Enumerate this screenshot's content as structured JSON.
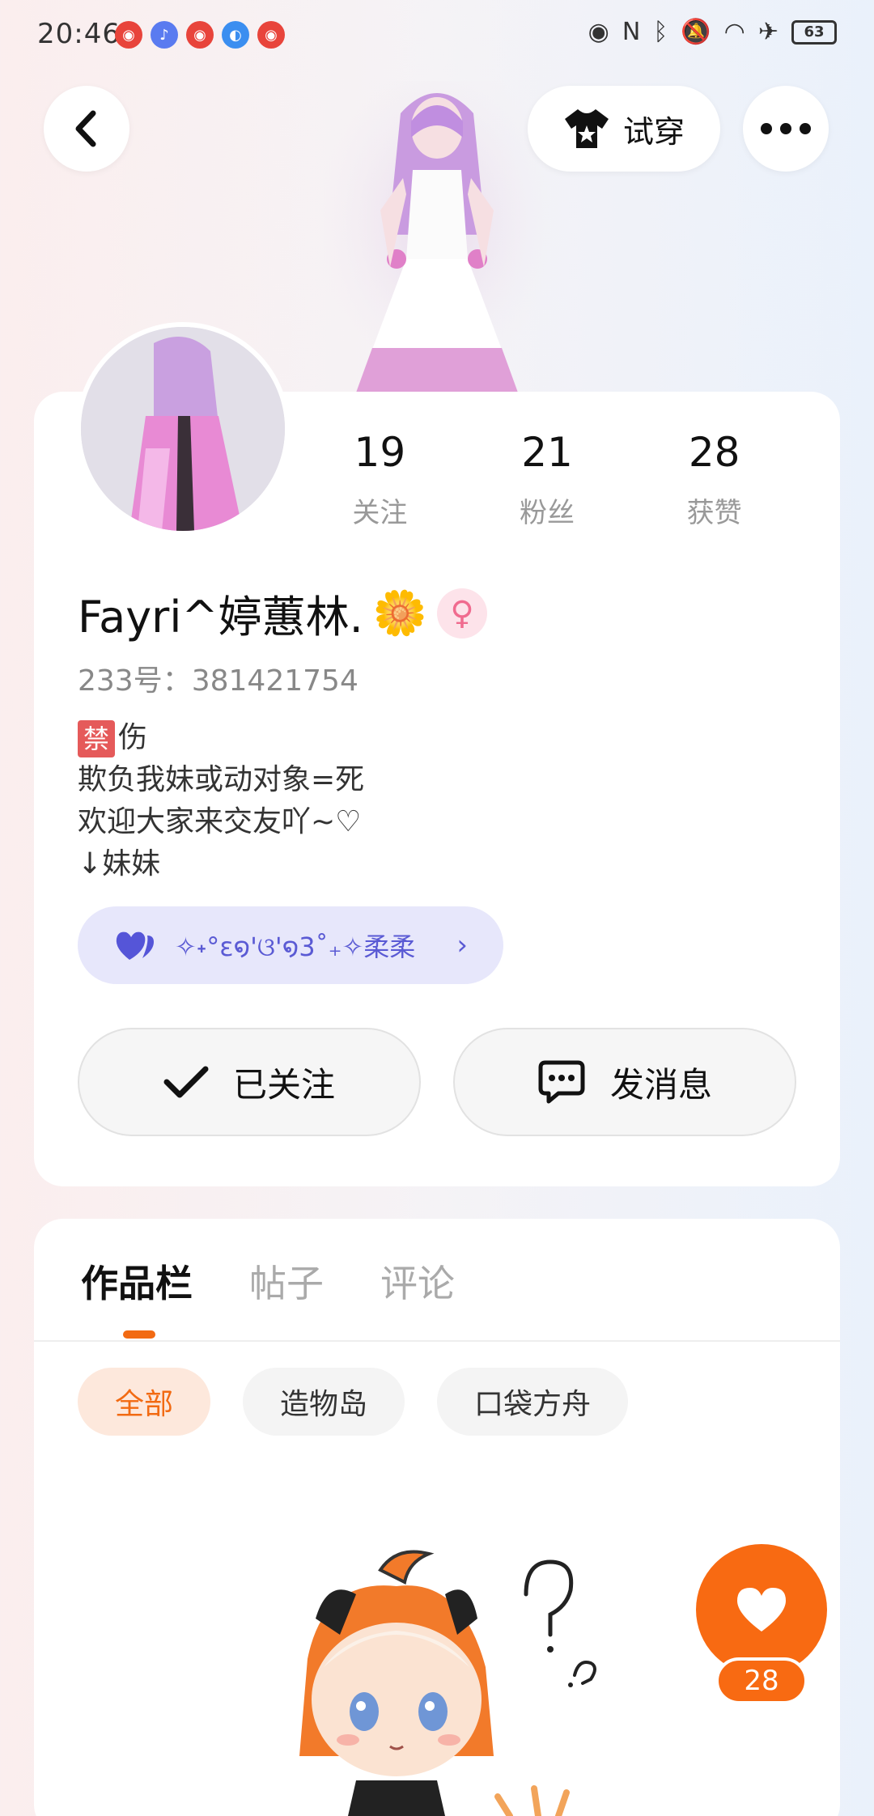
{
  "status_bar": {
    "time": "20:46",
    "battery": "63"
  },
  "header": {
    "try_on_label": "试穿"
  },
  "profile": {
    "stats": [
      {
        "value": "19",
        "label": "关注"
      },
      {
        "value": "21",
        "label": "粉丝"
      },
      {
        "value": "28",
        "label": "获赞"
      }
    ],
    "nickname": "Fayri^婷蕙林.",
    "uid": "233号：381421754",
    "bio_lines": [
      "伤",
      "欺负我妹或动对象=死",
      "欢迎大家来交友吖~♡",
      "↓妹妹"
    ],
    "bio_ban": "禁",
    "badge_text": "✧˖°ε໑'ଓ'໑3˚₊✧柔柔",
    "follow_label": "已关注",
    "message_label": "发消息"
  },
  "works": {
    "tabs": [
      "作品栏",
      "帖子",
      "评论"
    ],
    "filters": [
      "全部",
      "造物岛",
      "口袋方舟"
    ],
    "like_count": "28"
  },
  "colors": {
    "accent": "#f86a12",
    "badge_bg": "#e7e7fb",
    "badge_fg": "#5a5ad4"
  }
}
